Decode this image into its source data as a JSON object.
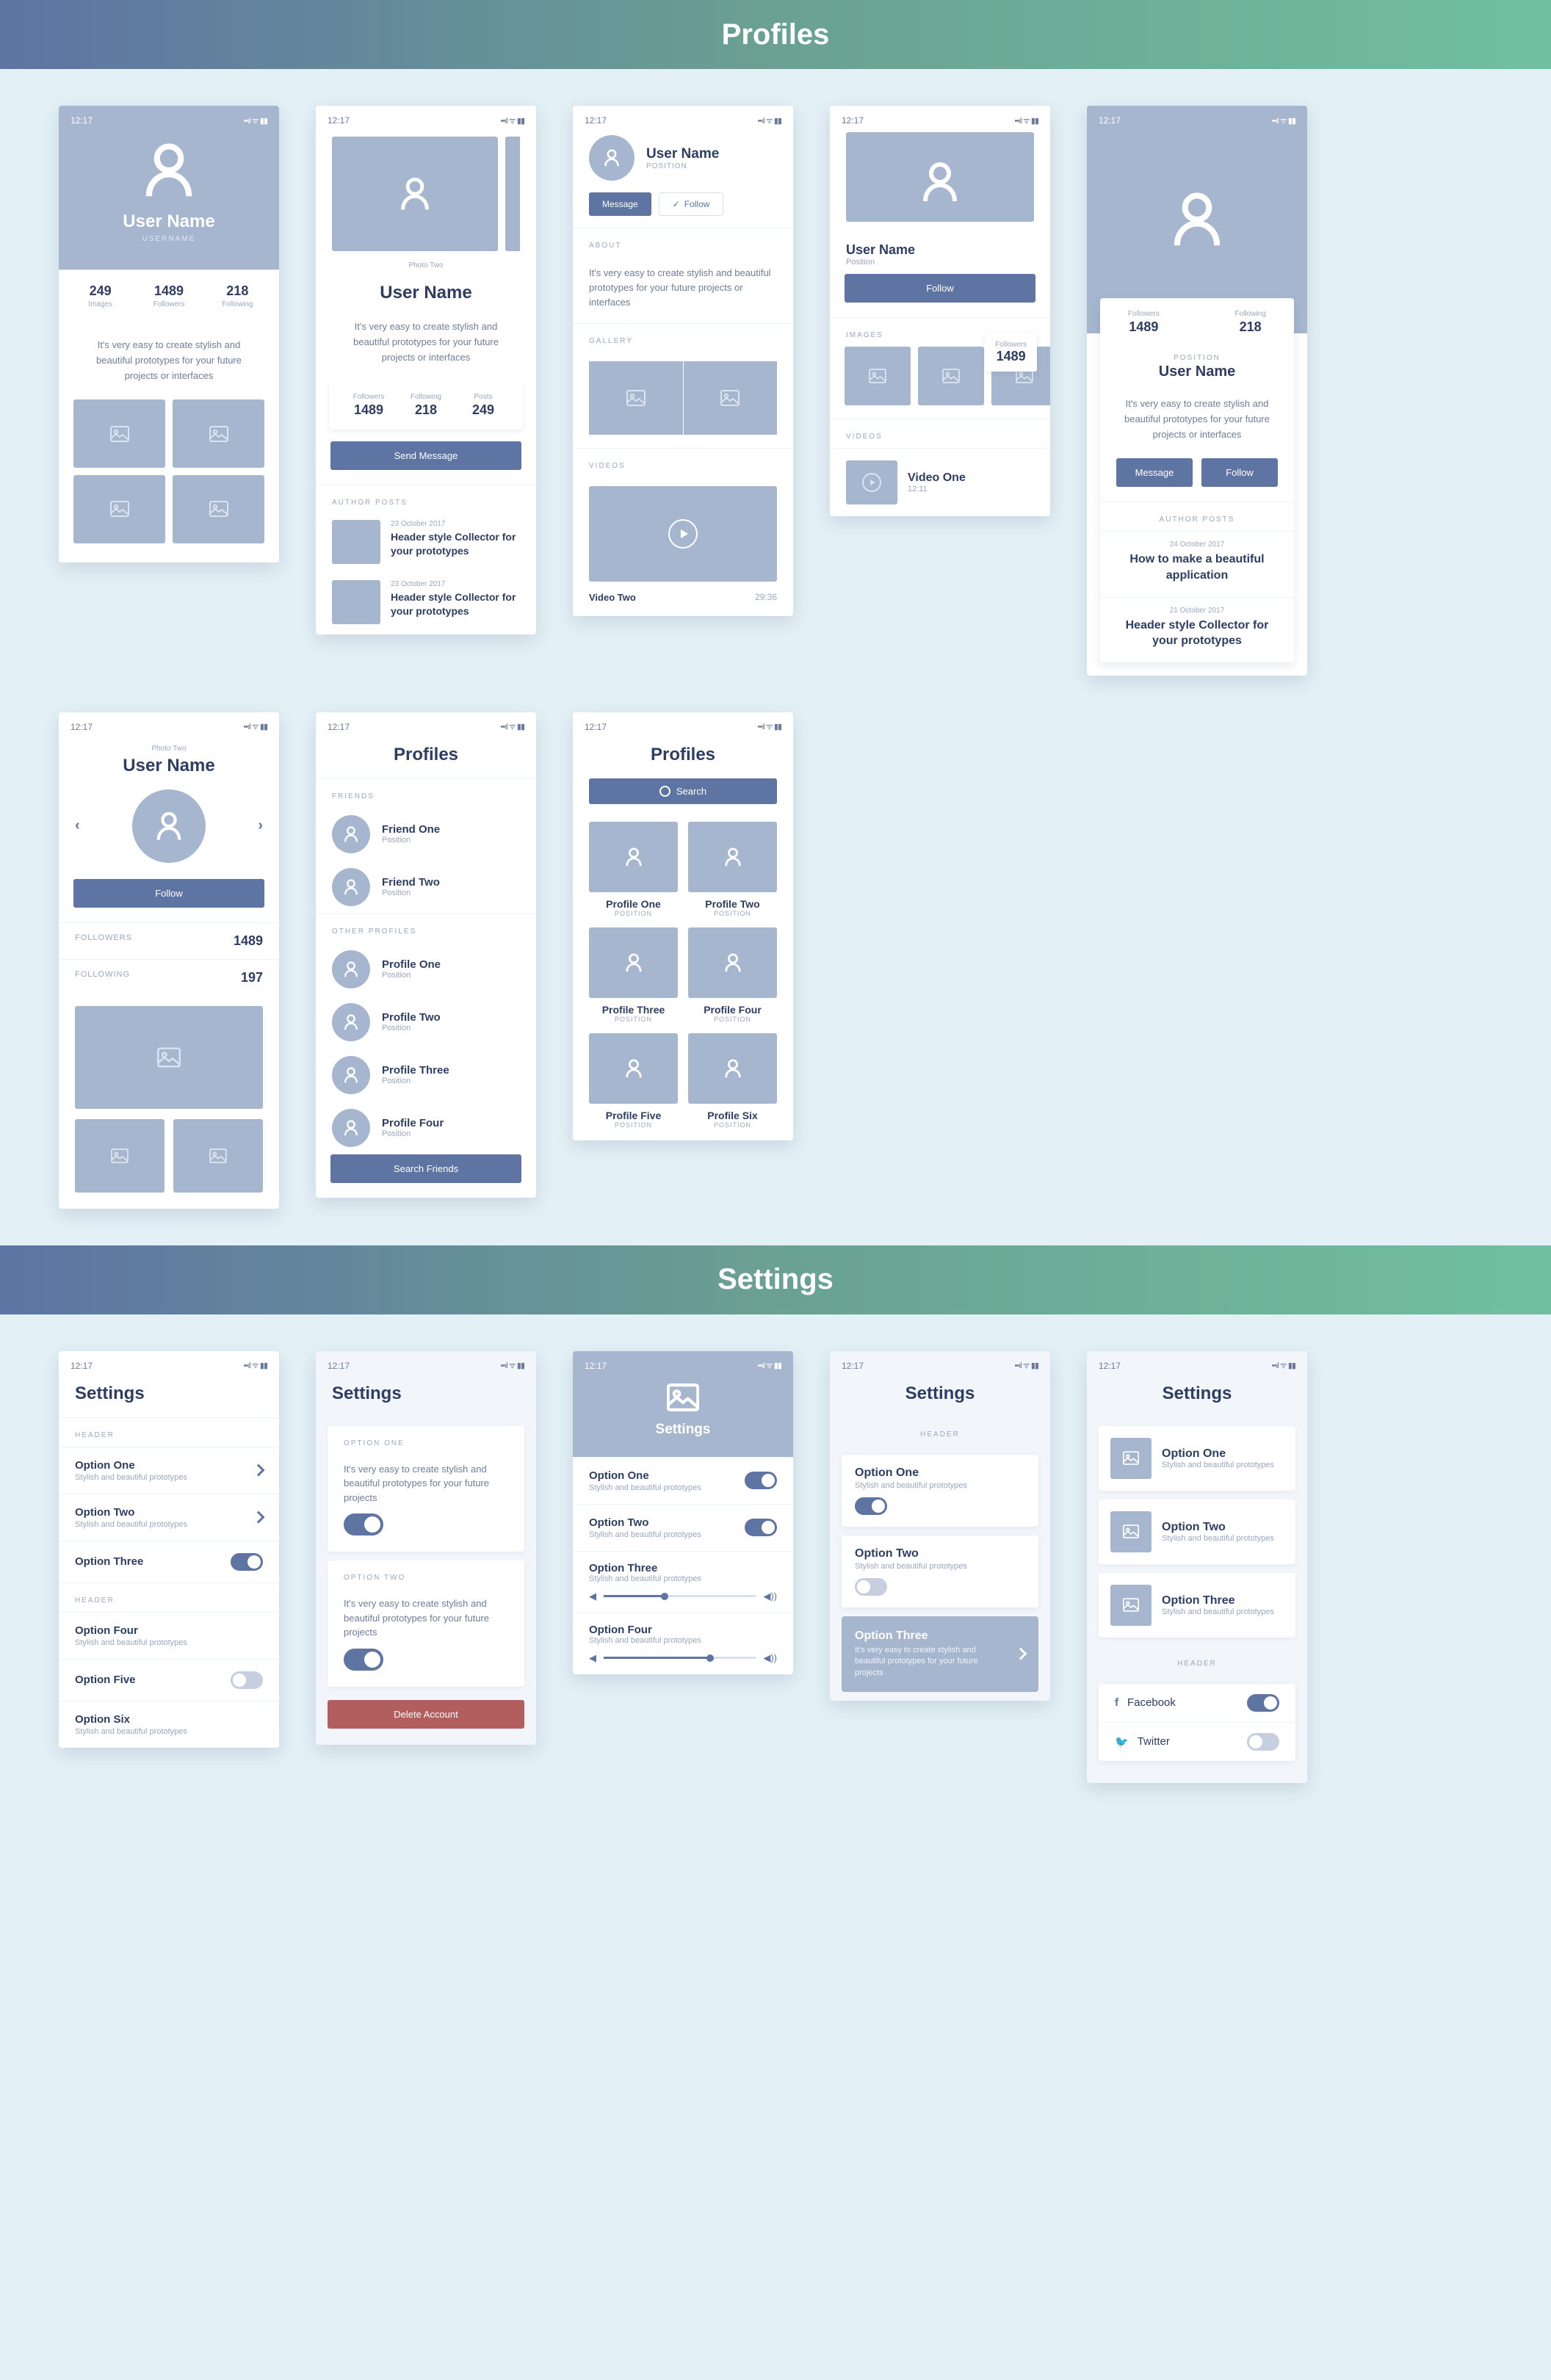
{
  "sections": {
    "profiles": "Profiles",
    "settings": "Settings"
  },
  "common": {
    "time": "12:17",
    "username": "User Name",
    "username_label": "USERNAME",
    "position": "POSITION",
    "position_lc": "Position",
    "desc": "It's very easy to create stylish and beautiful prototypes for your future projects or interfaces",
    "desc_short": "It's very easy to create stylish and beautiful prototypes for your future projects",
    "sub": "Stylish and beautiful prototypes",
    "photo_two": "Photo Two"
  },
  "p1": {
    "stats": [
      {
        "n": "249",
        "l": "Images"
      },
      {
        "n": "1489",
        "l": "Followers"
      },
      {
        "n": "218",
        "l": "Following"
      }
    ]
  },
  "p2": {
    "stats": [
      {
        "l": "Followers",
        "n": "1489"
      },
      {
        "l": "Following",
        "n": "218"
      },
      {
        "l": "Posts",
        "n": "249"
      }
    ],
    "send_message": "Send Message",
    "author_posts": "AUTHOR POSTS",
    "posts": [
      {
        "date": "23 October 2017",
        "title": "Header style Collector for your prototypes"
      },
      {
        "date": "23 October 2017",
        "title": "Header style Collector for your prototypes"
      }
    ]
  },
  "p3": {
    "message": "Message",
    "follow": "Follow",
    "about": "ABOUT",
    "gallery": "GALLERY",
    "videos": "VIDEOS",
    "video_name": "Video Two",
    "duration": "29:36"
  },
  "p4": {
    "followers_lbl": "Followers",
    "followers_n": "1489",
    "follow": "Follow",
    "images": "IMAGES",
    "videos": "VIDEOS",
    "video": {
      "name": "Video One",
      "dur": "12:11"
    }
  },
  "p5": {
    "stats": [
      {
        "l": "Followers",
        "n": "1489"
      },
      {
        "l": "Following",
        "n": "218"
      }
    ],
    "message": "Message",
    "follow": "Follow",
    "author_posts": "AUTHOR POSTS",
    "posts": [
      {
        "d": "24 October 2017",
        "t": "How to make a beautiful application"
      },
      {
        "d": "21 October 2017",
        "t": "Header style Collector for your prototypes"
      }
    ]
  },
  "p6": {
    "follow": "Follow",
    "followers_lbl": "FOLLOWERS",
    "followers_n": "1489",
    "following_lbl": "FOLLOWING",
    "following_n": "197"
  },
  "p7": {
    "title": "Profiles",
    "friends": "FRIENDS",
    "other": "OTHER PROFILES",
    "friends_list": [
      {
        "name": "Friend One",
        "pos": "Position"
      },
      {
        "name": "Friend Two",
        "pos": "Position"
      }
    ],
    "others_list": [
      {
        "name": "Profile One",
        "pos": "Position"
      },
      {
        "name": "Profile Two",
        "pos": "Position"
      },
      {
        "name": "Profile Three",
        "pos": "Position"
      },
      {
        "name": "Profile Four",
        "pos": "Position"
      }
    ],
    "search": "Search Friends"
  },
  "p8": {
    "title": "Profiles",
    "search": "Search",
    "cards": [
      "Profile One",
      "Profile Two",
      "Profile Three",
      "Profile Four",
      "Profile Five",
      "Profile Six"
    ],
    "pos": "POSITION"
  },
  "s1": {
    "title": "Settings",
    "header": "HEADER",
    "opts": [
      "Option One",
      "Option Two",
      "Option Three",
      "Option Four",
      "Option Five",
      "Option Six"
    ]
  },
  "s2": {
    "title": "Settings",
    "o1": "OPTION ONE",
    "o2": "OPTION TWO",
    "delete": "Delete Account"
  },
  "s3": {
    "title": "Settings",
    "opts": [
      "Option One",
      "Option Two",
      "Option Three",
      "Option Four"
    ]
  },
  "s4": {
    "title": "Settings",
    "header": "HEADER",
    "opts": [
      "Option One",
      "Option Two",
      "Option Three"
    ]
  },
  "s5": {
    "title": "Settings",
    "header": "HEADER",
    "opts": [
      "Option One",
      "Option Two",
      "Option Three"
    ],
    "socials": [
      {
        "name": "Facebook",
        "icon": "f"
      },
      {
        "name": "Twitter",
        "icon": "𝕏"
      }
    ]
  }
}
